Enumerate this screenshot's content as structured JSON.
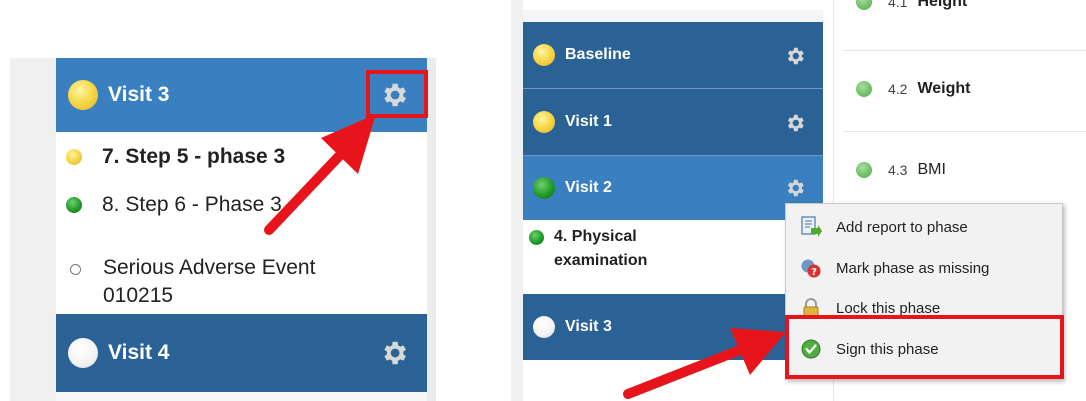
{
  "left_panel": {
    "phases": [
      {
        "label": "Visit 3",
        "status": "yellow"
      },
      {
        "label": "Visit 4",
        "status": "white"
      }
    ],
    "items": [
      {
        "label": "7. Step 5 - phase 3",
        "status": "yellow",
        "bold": true
      },
      {
        "label": "8. Step 6 - Phase 3",
        "status": "green",
        "bold": false
      },
      {
        "line1": "Serious Adverse Event",
        "line2": "010215",
        "status": "empty",
        "bold": false
      }
    ]
  },
  "right_panel": {
    "phases": [
      {
        "label": "Baseline",
        "status": "yellow"
      },
      {
        "label": "Visit 1",
        "status": "yellow"
      },
      {
        "label": "Visit 2",
        "status": "green"
      },
      {
        "label": "Visit 3",
        "status": "white"
      }
    ],
    "item": {
      "line1": "4. Physical",
      "line2": "examination",
      "status": "green"
    },
    "fields": [
      {
        "num": "4.1",
        "label": "Height"
      },
      {
        "num": "4.2",
        "label": "Weight"
      },
      {
        "num": "4.3",
        "label": "BMI"
      }
    ],
    "context_menu": {
      "items": [
        {
          "label": "Add report to phase",
          "icon": "add-report-icon"
        },
        {
          "label": "Mark phase as missing",
          "icon": "mark-missing-icon"
        },
        {
          "label": "Lock this phase",
          "icon": "lock-icon"
        },
        {
          "label": "Sign this phase",
          "icon": "sign-check-icon"
        }
      ]
    }
  },
  "colors": {
    "phase_active": "#3a80c1",
    "phase_default": "#2b6296",
    "highlight": "#e8141b",
    "arrow": "#e8141b"
  }
}
